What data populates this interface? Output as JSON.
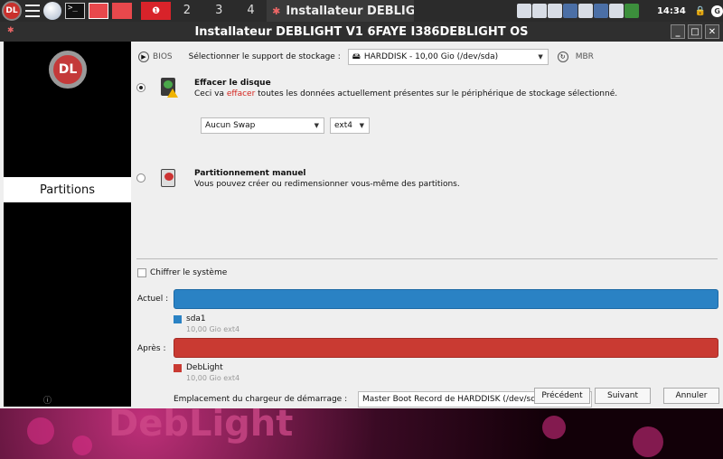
{
  "taskbar": {
    "logo_text": "DL",
    "terminal_glyph": ">_",
    "desktops": [
      "2",
      "3",
      "4"
    ],
    "active_window": "Installateur DEBLIG",
    "clock": "14:34",
    "g_label": "G"
  },
  "window": {
    "title": "Installateur DEBLIGHT V1 6FAYE I386DEBLIGHT OS",
    "min_label": "_",
    "max_label": "□",
    "close_label": "✕"
  },
  "sidebar": {
    "logo_text": "DL",
    "active_step": "Partitions",
    "info_glyph": "ⓘ"
  },
  "storage": {
    "bios_label": "BIOS",
    "select_label": "Sélectionner le support de stockage :",
    "selected_disk": "HARDDISK - 10,00 Gio (/dev/sda)",
    "mbr_label": "MBR"
  },
  "option_erase": {
    "title": "Effacer le disque",
    "desc_before": "Ceci va ",
    "desc_highlight": "effacer",
    "desc_after": " toutes les données actuellement présentes sur le périphérique de stockage sélectionné.",
    "swap_value": "Aucun Swap",
    "fs_value": "ext4"
  },
  "option_manual": {
    "title": "Partitionnement manuel",
    "desc": "Vous pouvez créer ou redimensionner vous-même des partitions."
  },
  "encrypt_label": "Chiffrer le système",
  "current": {
    "label": "Actuel :",
    "partition_name": "sda1",
    "partition_info": "10,00 Gio ext4",
    "color": "#2a82c4"
  },
  "after": {
    "label": "Après :",
    "partition_name": "DebLight",
    "partition_info": "10,00 Gio ext4",
    "color": "#c93a32"
  },
  "bootloader": {
    "label": "Emplacement du chargeur de démarrage :",
    "value": "Master Boot Record de HARDDISK (/dev/sda)"
  },
  "buttons": {
    "back": "Précédent",
    "next": "Suivant",
    "cancel": "Annuler"
  },
  "wallpaper_text": "DebLight"
}
